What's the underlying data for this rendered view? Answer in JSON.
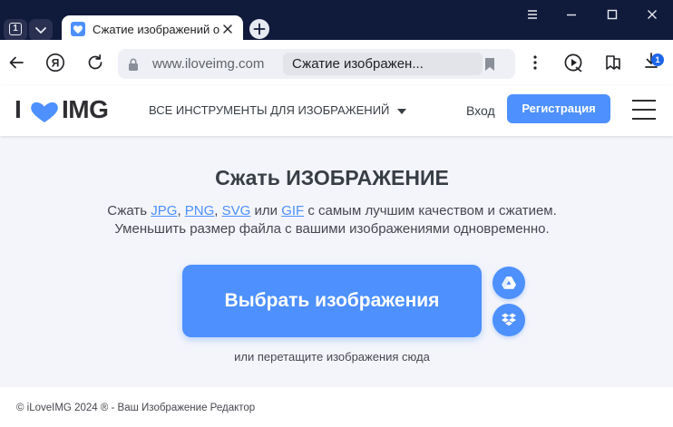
{
  "browser": {
    "tab_count": "1",
    "active_tab_title": "Сжатие изображений о",
    "address": {
      "domain": "www.iloveimg.com",
      "page_title": "Сжатие изображен..."
    },
    "downloads_badge": "1"
  },
  "site": {
    "logo": {
      "left": "I",
      "right": "IMG",
      "heart_color": "#4d90fe"
    },
    "tools_menu_label": "ВСЕ ИНСТРУМЕНТЫ ДЛЯ ИЗОБРАЖЕНИЙ",
    "login_label": "Вход",
    "register_label": "Регистрация"
  },
  "main": {
    "headline": "Сжать ИЗОБРАЖЕНИЕ",
    "subtitle1": {
      "prefix": "Сжать ",
      "link1": "JPG",
      "sep1": ", ",
      "link2": "PNG",
      "sep2": ", ",
      "link3": "SVG",
      "sep3": " или ",
      "link4": "GIF",
      "suffix": " с самым лучшим качеством и сжатием."
    },
    "subtitle2": "Уменьшить размер файла с вашими изображениями одновременно.",
    "select_button": "Выбрать изображения",
    "cloud_sources": [
      "google-drive-icon",
      "dropbox-icon"
    ],
    "drop_hint": "или перетащите изображения сюда"
  },
  "footer": {
    "copyright": "© iLoveIMG 2024 ® - Ваш Изображение Редактор"
  },
  "colors": {
    "accent": "#4d90fe",
    "tabstrip": "#101a3a",
    "page_bg": "#f4f5fb"
  }
}
